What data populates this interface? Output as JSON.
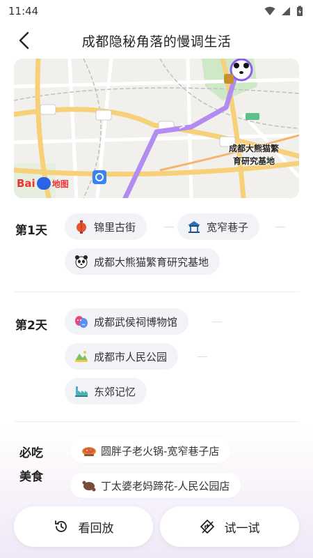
{
  "status_bar": {
    "time": "11:44"
  },
  "header": {
    "title": "成都隐秘角落的慢调生活"
  },
  "map": {
    "poi_label_line1": "成都大熊猫繁",
    "poi_label_line2": "育研究基地",
    "logo_bai": "Bai",
    "logo_ditu": "地图"
  },
  "days": [
    {
      "label": "第1天",
      "stops": [
        {
          "name": "锦里古街",
          "icon": "lantern-icon"
        },
        {
          "name": "宽窄巷子",
          "icon": "pavilion-icon"
        },
        {
          "name": "成都大熊猫繁育研究基地",
          "icon": "panda-icon"
        }
      ]
    },
    {
      "label": "第2天",
      "stops": [
        {
          "name": "成都武侯祠博物馆",
          "icon": "opera-mask-icon"
        },
        {
          "name": "成都市人民公园",
          "icon": "park-icon"
        },
        {
          "name": "东郊记忆",
          "icon": "factory-icon"
        }
      ]
    }
  ],
  "food": {
    "label_line1": "必吃",
    "label_line2": "美食",
    "items": [
      {
        "name": "圆胖子老火锅-宽窄巷子店",
        "icon": "hotpot-icon"
      },
      {
        "name": "丁太婆老妈蹄花-人民公园店",
        "icon": "trotter-icon"
      }
    ]
  },
  "actions": {
    "replay_label": "看回放",
    "try_label": "试一试"
  },
  "colors": {
    "route": "#b28cf0",
    "road_major": "#f7d37a",
    "accent_bg": "#efe8f7"
  }
}
